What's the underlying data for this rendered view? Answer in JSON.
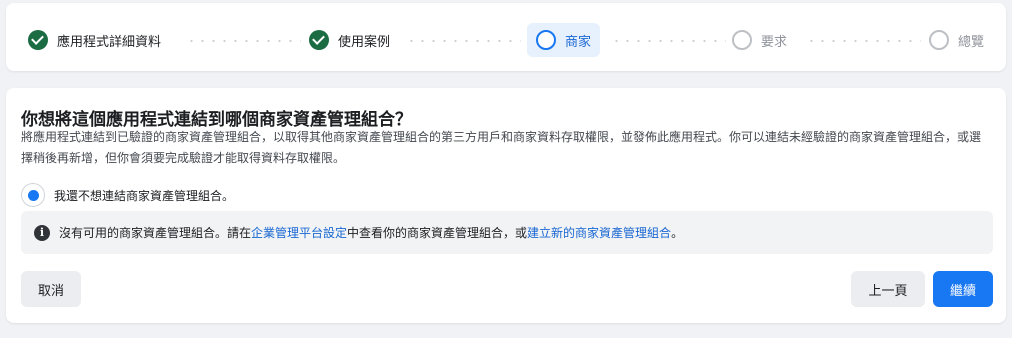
{
  "stepper": {
    "steps": [
      {
        "label": "應用程式詳細資料",
        "state": "completed"
      },
      {
        "label": "使用案例",
        "state": "completed"
      },
      {
        "label": "商家",
        "state": "current"
      },
      {
        "label": "要求",
        "state": "upcoming"
      },
      {
        "label": "總覽",
        "state": "upcoming"
      }
    ]
  },
  "main": {
    "title": "你想將這個應用程式連結到哪個商家資產管理組合？",
    "description": "將應用程式連結到已驗證的商家資產管理組合，以取得其他商家資產管理組合的第三方用戶和商家資料存取權限，並發佈此應用程式。你可以連結未經驗證的商家資產管理組合，或選擇稍後再新增，但你會須要完成驗證才能取得資料存取權限。",
    "radio_option": {
      "label": "我還不想連結商家資產管理組合。",
      "selected": true
    },
    "info": {
      "text_before": "沒有可用的商家資產管理組合。請在",
      "link1": "企業管理平台設定",
      "text_middle": "中查看你的商家資產管理組合，或",
      "link2": "建立新的商家資產管理組合",
      "text_after": "。"
    }
  },
  "footer": {
    "cancel_label": "取消",
    "prev_label": "上一頁",
    "next_label": "繼續"
  },
  "colors": {
    "primary": "#1877f2",
    "completed": "#1b6b43",
    "link": "#1967d2"
  }
}
